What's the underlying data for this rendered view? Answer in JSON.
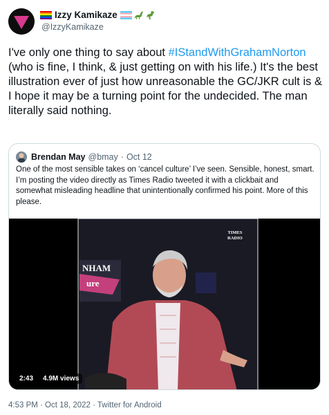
{
  "author": {
    "name": "Izzy Kamikaze",
    "handle": "@IzzyKamikaze",
    "name_emojis_left": [
      "rainbow-flag"
    ],
    "name_emojis_right": [
      "trans-flag",
      "sauropod",
      "t-rex"
    ]
  },
  "tweet": {
    "text_before": "I've only one thing to say about ",
    "hashtag": "#IStandWithGrahamNorton",
    "text_after": " (who is fine, I think, & just getting on with his life.) It's the best illustration ever of just how unreasonable the GC/JKR cult is & I hope it may be a turning point for the undecided. The man literally said nothing."
  },
  "quoted": {
    "name": "Brendan May",
    "handle": "@bmay",
    "separator": "·",
    "date": "Oct 12",
    "text": "One of the most sensible takes on ‘cancel culture’ I’ve seen. Sensible, honest, smart. I’m posting the video directly as Times Radio tweeted it with a clickbait and somewhat misleading headline that unintentionally confirmed his point. More of this please.",
    "video": {
      "duration": "2:43",
      "views": "4.9M views",
      "logo_line1": "TIMES",
      "logo_line2": "RADIO",
      "backdrop_text_1": "NHAM",
      "backdrop_text_2": "ure"
    }
  },
  "footer": {
    "meta": "4:53 PM · Oct 18, 2022 · Twitter for Android"
  },
  "colors": {
    "link": "#1d9bf0",
    "secondary_text": "#536471",
    "border": "#cfd9de",
    "avatar_triangle": "#d63a8c",
    "jacket": "#b24a55"
  }
}
